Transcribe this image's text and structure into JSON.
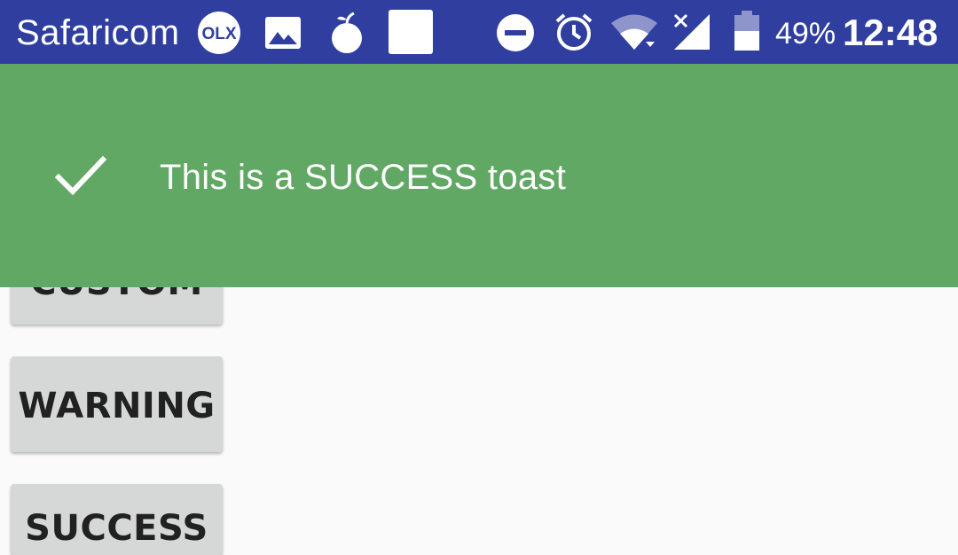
{
  "status_bar": {
    "carrier": "Safaricom",
    "olx_label": "OLX",
    "battery_percent": "49%",
    "time": "12:48",
    "icons": [
      "olx-icon",
      "image-icon",
      "fruit-app-icon",
      "blank-square-icon",
      "do-not-disturb-icon",
      "alarm-icon",
      "wifi-icon",
      "signal-no-service-icon",
      "battery-icon"
    ],
    "colors": {
      "background": "#303f9f",
      "foreground": "#ffffff"
    }
  },
  "toast": {
    "icon": "checkmark-icon",
    "message": "This is a SUCCESS toast",
    "color": "#62a865"
  },
  "buttons": {
    "custom_label": "CUSTOM",
    "warning_label": "WARNING",
    "success_label": "SUCCESS",
    "color": "#d6d7d7"
  }
}
